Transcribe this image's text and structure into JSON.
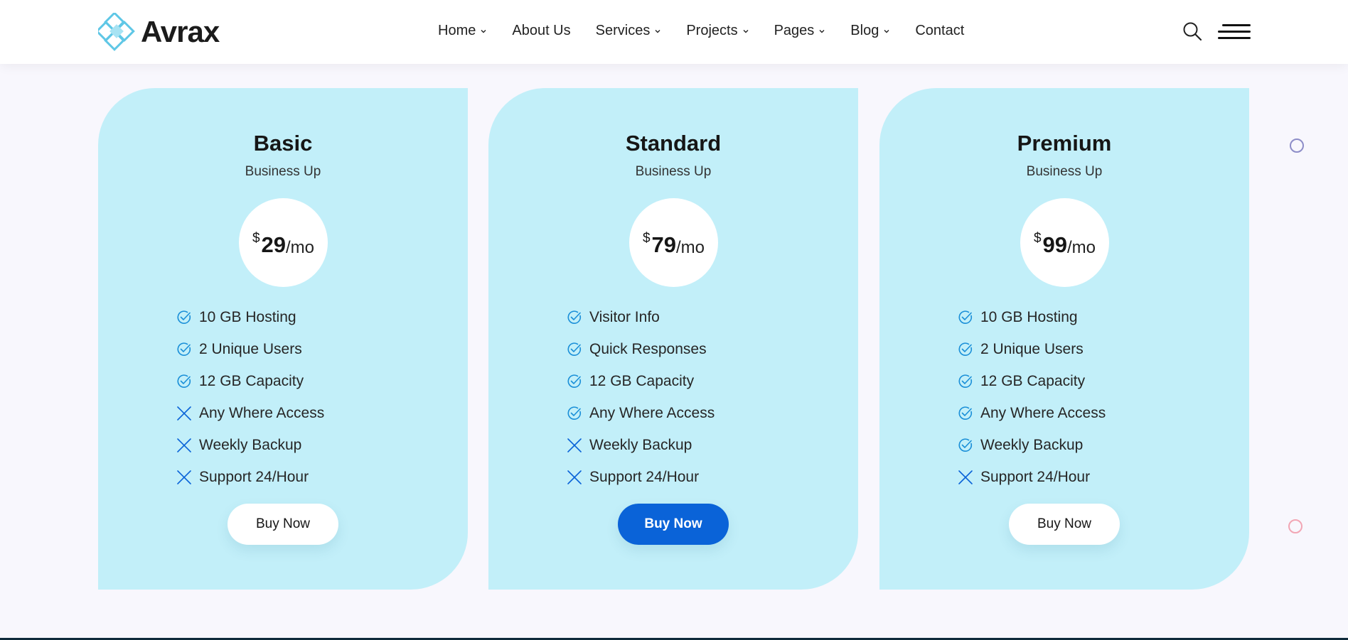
{
  "header": {
    "brand": "Avrax",
    "nav": [
      {
        "label": "Home",
        "dropdown": true
      },
      {
        "label": "About Us",
        "dropdown": false
      },
      {
        "label": "Services",
        "dropdown": true
      },
      {
        "label": "Projects",
        "dropdown": true
      },
      {
        "label": "Pages",
        "dropdown": true
      },
      {
        "label": "Blog",
        "dropdown": true
      },
      {
        "label": "Contact",
        "dropdown": false
      }
    ],
    "icons": {
      "search": "search-icon",
      "menu": "hamburger-menu-icon"
    }
  },
  "pricing": {
    "plans": [
      {
        "name": "Basic",
        "subtitle": "Business Up",
        "currency": "$",
        "amount": "29",
        "period": "/mo",
        "features": [
          {
            "text": "10 GB Hosting",
            "included": true
          },
          {
            "text": "2 Unique Users",
            "included": true
          },
          {
            "text": "12 GB Capacity",
            "included": true
          },
          {
            "text": "Any Where Access",
            "included": false
          },
          {
            "text": "Weekly Backup",
            "included": false
          },
          {
            "text": "Support 24/Hour",
            "included": false
          }
        ],
        "button": "Buy Now",
        "highlighted": false
      },
      {
        "name": "Standard",
        "subtitle": "Business Up",
        "currency": "$",
        "amount": "79",
        "period": "/mo",
        "features": [
          {
            "text": "Visitor Info",
            "included": true
          },
          {
            "text": "Quick Responses",
            "included": true
          },
          {
            "text": "12 GB Capacity",
            "included": true
          },
          {
            "text": "Any Where Access",
            "included": true
          },
          {
            "text": "Weekly Backup",
            "included": false
          },
          {
            "text": "Support 24/Hour",
            "included": false
          }
        ],
        "button": "Buy Now",
        "highlighted": true
      },
      {
        "name": "Premium",
        "subtitle": "Business Up",
        "currency": "$",
        "amount": "99",
        "period": "/mo",
        "features": [
          {
            "text": "10 GB Hosting",
            "included": true
          },
          {
            "text": "2 Unique Users",
            "included": true
          },
          {
            "text": "12 GB Capacity",
            "included": true
          },
          {
            "text": "Any Where Access",
            "included": true
          },
          {
            "text": "Weekly Backup",
            "included": true
          },
          {
            "text": "Support 24/Hour",
            "included": false
          }
        ],
        "button": "Buy Now",
        "highlighted": false
      }
    ]
  },
  "colors": {
    "card_bg": "#c2eff9",
    "accent": "#0a63d8",
    "check_icon": "#1a8fd8",
    "cross_icon": "#0a63d8",
    "page_bg": "#f8f7fd"
  }
}
